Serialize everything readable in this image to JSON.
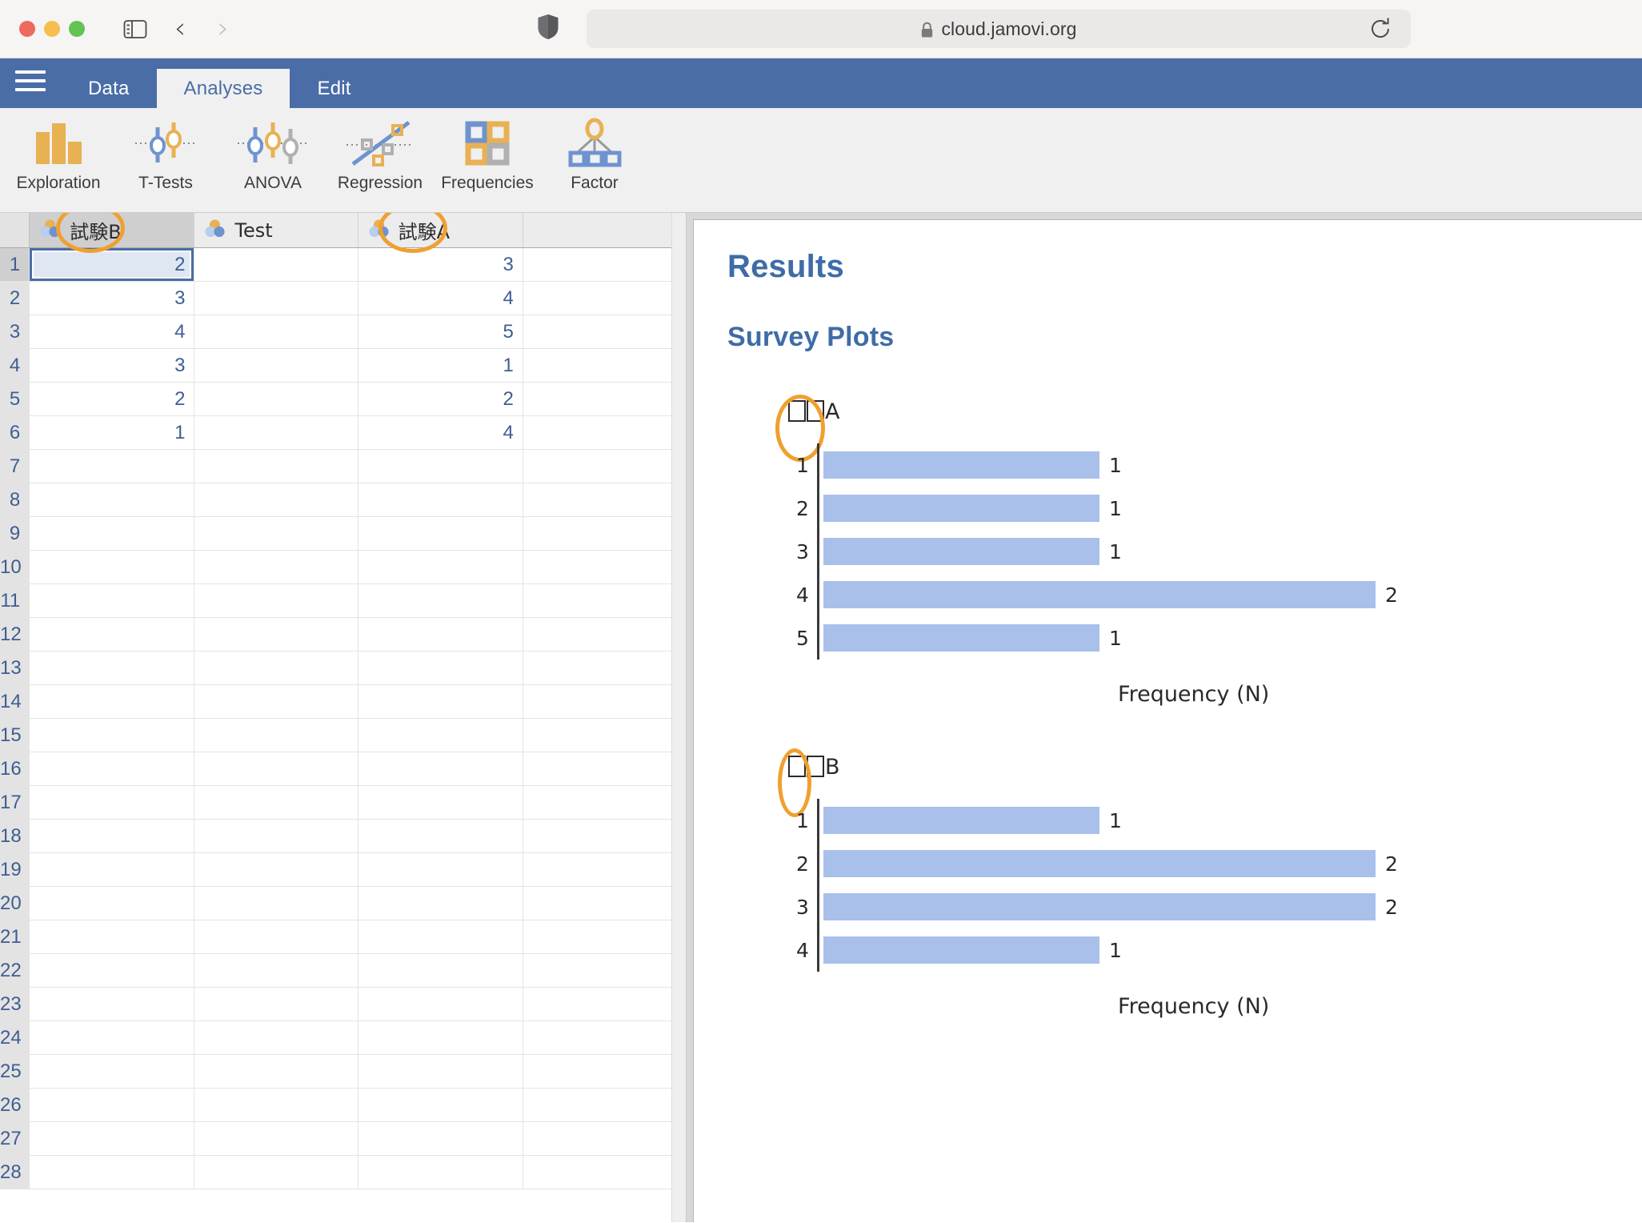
{
  "browser": {
    "url": "cloud.jamovi.org",
    "lock_icon": "lock-icon",
    "shield_icon": "shield-icon",
    "reload_icon": "reload-icon",
    "sidebar_icon": "sidebar-toggle-icon",
    "back_icon": "chevron-left-icon",
    "forward_icon": "chevron-right-icon",
    "traffic_lights": [
      "close",
      "minimize",
      "zoom"
    ]
  },
  "app": {
    "tabs": [
      {
        "label": "Data",
        "active": false
      },
      {
        "label": "Analyses",
        "active": true
      },
      {
        "label": "Edit",
        "active": false
      }
    ],
    "menu_icon": "hamburger-menu-icon",
    "ribbon": [
      {
        "label": "Exploration",
        "icon": "bar-chart-icon"
      },
      {
        "label": "T-Tests",
        "icon": "t-tests-icon"
      },
      {
        "label": "ANOVA",
        "icon": "anova-icon"
      },
      {
        "label": "Regression",
        "icon": "scatter-regression-icon"
      },
      {
        "label": "Frequencies",
        "icon": "frequencies-grid-icon"
      },
      {
        "label": "Factor",
        "icon": "factor-tree-icon"
      }
    ]
  },
  "spreadsheet": {
    "columns": [
      {
        "name": "試験B",
        "icon": "nominal-variable-icon",
        "selected": true,
        "annotated": true
      },
      {
        "name": "Test",
        "icon": "nominal-variable-icon",
        "selected": false,
        "annotated": false
      },
      {
        "name": "試験A",
        "icon": "nominal-variable-icon",
        "selected": false,
        "annotated": true
      },
      {
        "name": "",
        "icon": "",
        "selected": false,
        "annotated": false
      }
    ],
    "rows": [
      {
        "n": "1",
        "cells": [
          "2",
          "",
          "3",
          ""
        ]
      },
      {
        "n": "2",
        "cells": [
          "3",
          "",
          "4",
          ""
        ]
      },
      {
        "n": "3",
        "cells": [
          "4",
          "",
          "5",
          ""
        ]
      },
      {
        "n": "4",
        "cells": [
          "3",
          "",
          "1",
          ""
        ]
      },
      {
        "n": "5",
        "cells": [
          "2",
          "",
          "2",
          ""
        ]
      },
      {
        "n": "6",
        "cells": [
          "1",
          "",
          "4",
          ""
        ]
      },
      {
        "n": "7",
        "cells": [
          "",
          "",
          "",
          ""
        ]
      },
      {
        "n": "8",
        "cells": [
          "",
          "",
          "",
          ""
        ]
      },
      {
        "n": "9",
        "cells": [
          "",
          "",
          "",
          ""
        ]
      },
      {
        "n": "10",
        "cells": [
          "",
          "",
          "",
          ""
        ]
      },
      {
        "n": "11",
        "cells": [
          "",
          "",
          "",
          ""
        ]
      },
      {
        "n": "12",
        "cells": [
          "",
          "",
          "",
          ""
        ]
      },
      {
        "n": "13",
        "cells": [
          "",
          "",
          "",
          ""
        ]
      },
      {
        "n": "14",
        "cells": [
          "",
          "",
          "",
          ""
        ]
      },
      {
        "n": "15",
        "cells": [
          "",
          "",
          "",
          ""
        ]
      },
      {
        "n": "16",
        "cells": [
          "",
          "",
          "",
          ""
        ]
      },
      {
        "n": "17",
        "cells": [
          "",
          "",
          "",
          ""
        ]
      },
      {
        "n": "18",
        "cells": [
          "",
          "",
          "",
          ""
        ]
      },
      {
        "n": "19",
        "cells": [
          "",
          "",
          "",
          ""
        ]
      },
      {
        "n": "20",
        "cells": [
          "",
          "",
          "",
          ""
        ]
      },
      {
        "n": "21",
        "cells": [
          "",
          "",
          "",
          ""
        ]
      },
      {
        "n": "22",
        "cells": [
          "",
          "",
          "",
          ""
        ]
      },
      {
        "n": "23",
        "cells": [
          "",
          "",
          "",
          ""
        ]
      },
      {
        "n": "24",
        "cells": [
          "",
          "",
          "",
          ""
        ]
      },
      {
        "n": "25",
        "cells": [
          "",
          "",
          "",
          ""
        ]
      },
      {
        "n": "26",
        "cells": [
          "",
          "",
          "",
          ""
        ]
      },
      {
        "n": "27",
        "cells": [
          "",
          "",
          "",
          ""
        ]
      },
      {
        "n": "28",
        "cells": [
          "",
          "",
          "",
          ""
        ]
      }
    ],
    "selected_cell": {
      "row": 0,
      "col": 0,
      "value": "2"
    },
    "filled_row_count": 6
  },
  "results": {
    "title": "Results",
    "section_title": "Survey Plots"
  },
  "chart_data": [
    {
      "type": "bar",
      "orientation": "horizontal",
      "title": "□□A",
      "title_note": "variable name rendered as two missing-glyph boxes followed by A (原: 試験A)",
      "categories": [
        "1",
        "2",
        "3",
        "4",
        "5"
      ],
      "values": [
        1,
        1,
        1,
        2,
        1
      ],
      "labels": [
        "1",
        "1",
        "1",
        "2",
        "1"
      ],
      "xlabel": "Frequency (N)",
      "ylabel": "",
      "xlim": [
        0,
        2
      ],
      "grid": false,
      "bar_color": "#a8c0ea",
      "annotated": true
    },
    {
      "type": "bar",
      "orientation": "horizontal",
      "title": "□□B",
      "title_note": "variable name rendered as two missing-glyph boxes followed by B (原: 試験B)",
      "categories": [
        "1",
        "2",
        "3",
        "4"
      ],
      "values": [
        1,
        2,
        2,
        1
      ],
      "labels": [
        "1",
        "2",
        "2",
        "1"
      ],
      "xlabel": "Frequency (N)",
      "ylabel": "",
      "xlim": [
        0,
        2
      ],
      "grid": false,
      "bar_color": "#a8c0ea",
      "annotated": true
    }
  ],
  "annotations": {
    "color": "#f0a030",
    "marks": [
      {
        "target": "column-header-1",
        "shape": "ellipse"
      },
      {
        "target": "column-header-3",
        "shape": "ellipse"
      },
      {
        "target": "plot-1-title",
        "shape": "ellipse"
      },
      {
        "target": "plot-2-title",
        "shape": "ellipse"
      }
    ]
  }
}
